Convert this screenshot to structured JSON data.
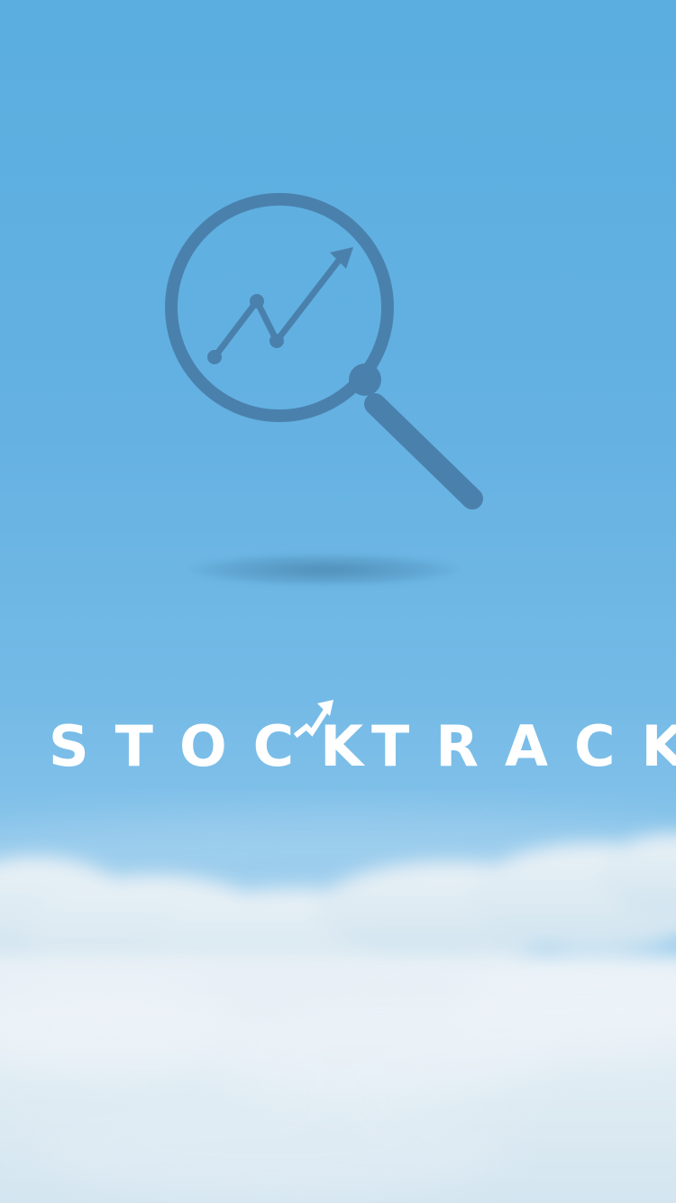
{
  "app": {
    "word_left": "STOCK",
    "word_right": "TRACK"
  },
  "logo": {
    "icon": "magnifier-with-trend-chart-icon",
    "color": "#4a81ac"
  },
  "wordmark": {
    "color": "#ffffff",
    "accent_icon": "trend-up-arrow-icon"
  },
  "background": {
    "sky_color": "#5aaee0",
    "cloud_color": "#e6eef4"
  }
}
